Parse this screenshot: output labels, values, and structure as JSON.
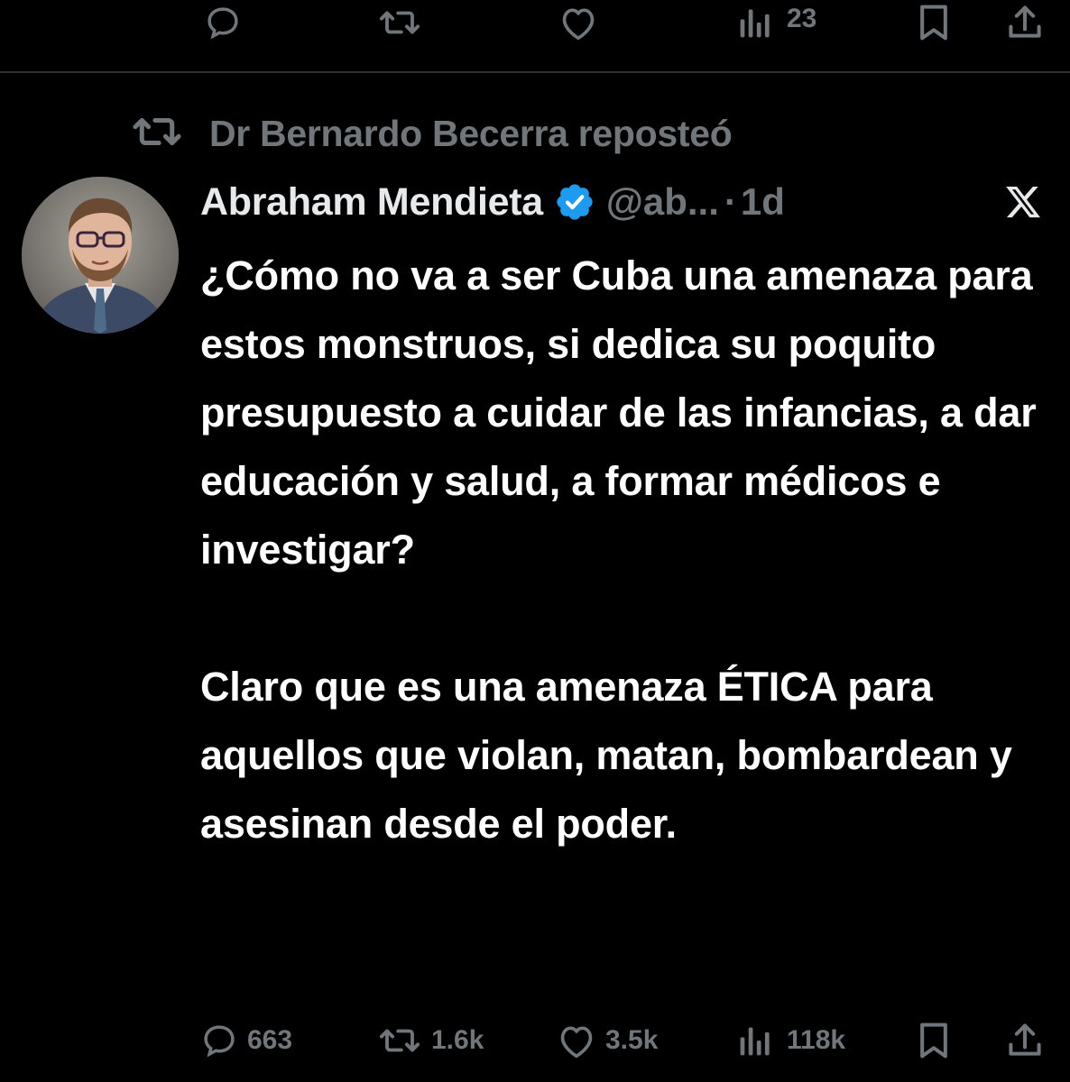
{
  "top_actions": {
    "views_count": "23"
  },
  "repost": {
    "text": "Dr Bernardo Becerra reposteó"
  },
  "tweet": {
    "author_name": "Abraham Mendieta",
    "handle": "@ab...",
    "separator": "·",
    "time": "1d",
    "body_para1": "¿Cómo no va a ser Cuba una amenaza para estos monstruos, si dedica su poquito presupuesto a cuidar de las infancias, a dar educación y salud, a formar médicos e investigar?",
    "body_para2": "Claro que es una amenaza ÉTICA para aquellos que violan, matan, bombardean y asesinan desde el poder."
  },
  "bottom_actions": {
    "reply_count": "663",
    "retweet_count": "1.6k",
    "like_count": "3.5k",
    "views_count": "118k"
  },
  "colors": {
    "background": "#000000",
    "text_primary": "#e7e9ea",
    "text_secondary": "#71767b",
    "verified_blue": "#1d9bf0",
    "divider": "#2f3336"
  },
  "icons": [
    "reply-icon",
    "retweet-icon",
    "like-icon",
    "views-icon",
    "bookmark-icon",
    "share-icon",
    "verified-badge-icon",
    "x-logo-icon"
  ]
}
